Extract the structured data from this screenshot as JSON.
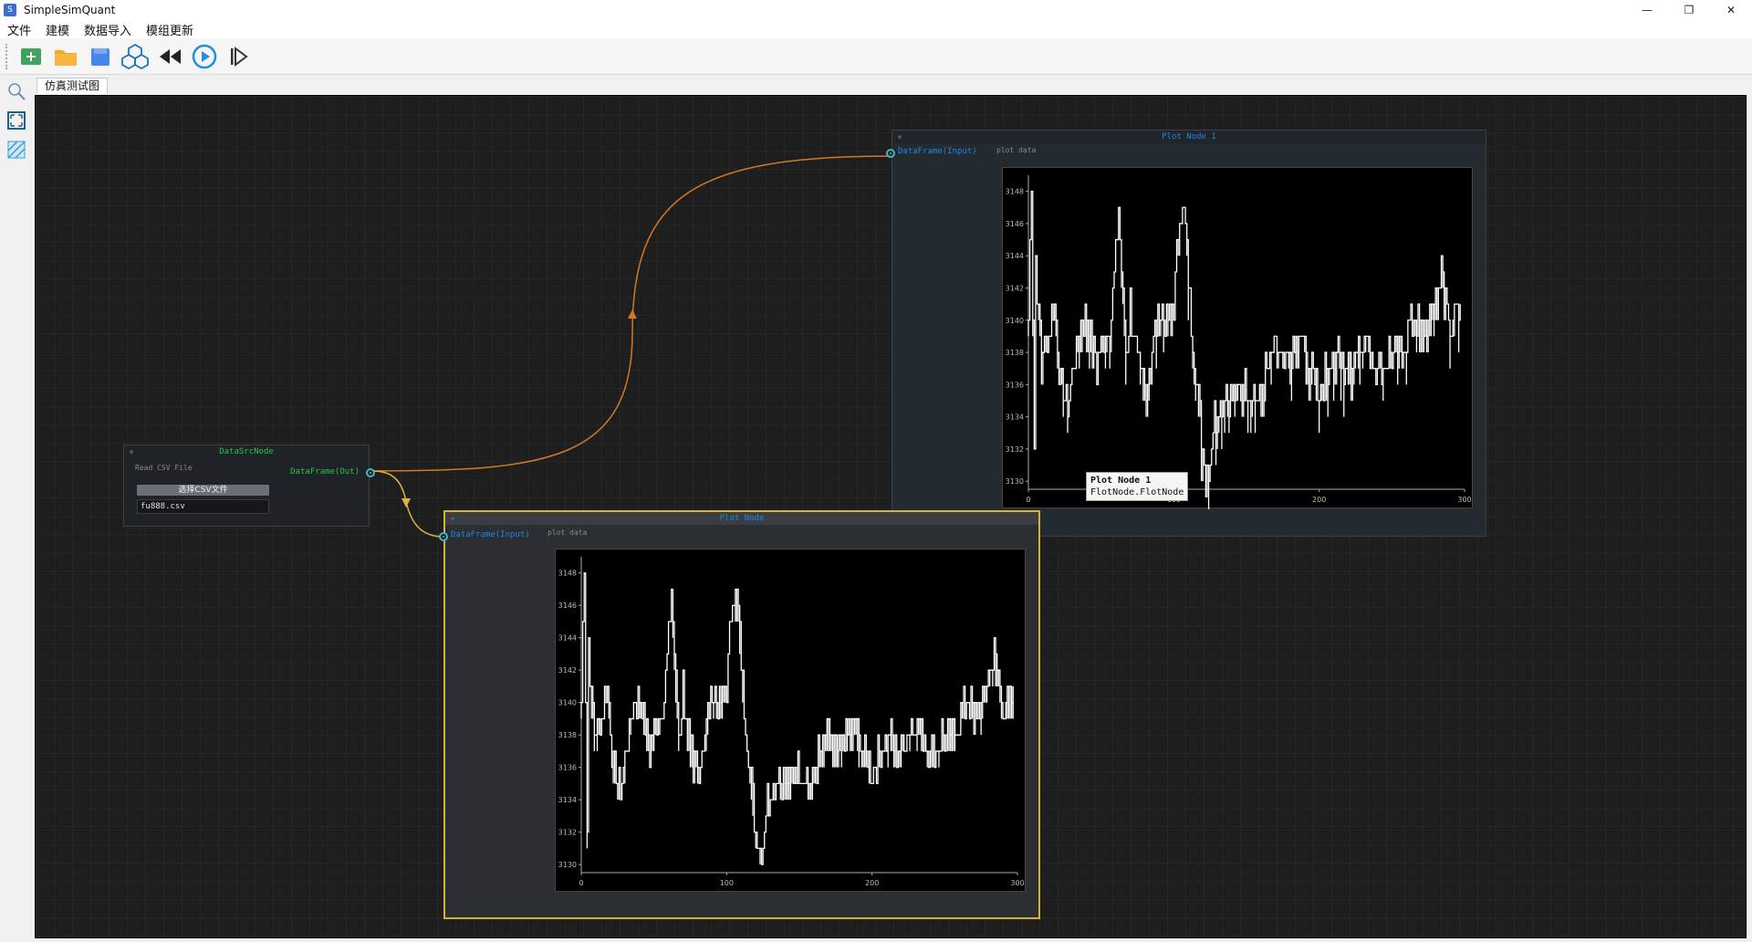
{
  "window": {
    "title": "SimpleSimQuant",
    "icon_letter": "S",
    "minimize": "—",
    "maximize": "❐",
    "close": "✕"
  },
  "menu": [
    "文件",
    "建模",
    "数据导入",
    "模组更新"
  ],
  "toolbar": {
    "icons": [
      "add-icon",
      "folder-icon",
      "save-icon",
      "cubes-icon",
      "rewind-icon",
      "play-icon",
      "step-icon"
    ]
  },
  "leftbar": {
    "icons": [
      "zoom-icon",
      "fit-view-icon",
      "hatch-grid-icon"
    ]
  },
  "tab": {
    "label": "仿真测试图"
  },
  "src_node": {
    "title": "DataSrcNode",
    "subtitle": "Read CSV File",
    "out_port": "DataFrame(Out)",
    "button_label": "选择CSV文件",
    "file_value": "fu888.csv"
  },
  "plot_node1": {
    "title": "Plot Node 1",
    "in_port": "DataFrame(Input)",
    "subtitle": "plot data",
    "tooltip_title": "Plot Node 1",
    "tooltip_sub": "FlotNode.FlotNode"
  },
  "plot_node2": {
    "title": "Plot Node",
    "in_port": "DataFrame(Input)",
    "subtitle": "plot data"
  },
  "colors": {
    "accent_green": "#22c84a",
    "accent_blue": "#1e88e5",
    "wire_orange": "#d07a26",
    "wire_yellow": "#e0b43a",
    "selected_border": "#d9b23a"
  },
  "chart_data": [
    {
      "type": "line",
      "xlim": [
        0,
        300
      ],
      "ylim": [
        3129.5,
        3149
      ],
      "x_ticks": [
        0,
        100,
        200,
        300
      ],
      "y_ticks": [
        3130,
        3132,
        3134,
        3136,
        3138,
        3140,
        3142,
        3144,
        3146,
        3148
      ],
      "anchors_x": [
        0,
        2,
        4,
        5,
        7,
        10,
        13,
        18,
        22,
        27,
        32,
        37,
        42,
        47,
        52,
        57,
        62,
        67,
        70,
        75,
        80,
        85,
        90,
        95,
        100,
        104,
        108,
        112,
        116,
        120,
        124,
        128,
        132,
        135,
        140,
        146,
        152,
        158,
        164,
        170,
        176,
        182,
        188,
        194,
        200,
        206,
        212,
        218,
        224,
        230,
        236,
        242,
        248,
        254,
        260,
        266,
        272,
        278,
        284,
        288,
        291,
        294,
        297
      ],
      "anchors_y": [
        3140,
        3149,
        3132.5,
        3144,
        3140,
        3138,
        3139,
        3141,
        3136,
        3135,
        3138,
        3140,
        3140,
        3137,
        3139,
        3140,
        3147,
        3138,
        3141,
        3137,
        3136,
        3138,
        3141,
        3140,
        3141,
        3147,
        3146,
        3140,
        3136,
        3132,
        3131,
        3134,
        3135,
        3136,
        3135,
        3136,
        3136,
        3135,
        3137,
        3138,
        3137,
        3138,
        3139,
        3137,
        3136,
        3137,
        3138,
        3137,
        3138,
        3139,
        3138,
        3137,
        3138,
        3138,
        3139,
        3140,
        3139,
        3141,
        3143,
        3141,
        3140,
        3140,
        3140
      ]
    }
  ]
}
